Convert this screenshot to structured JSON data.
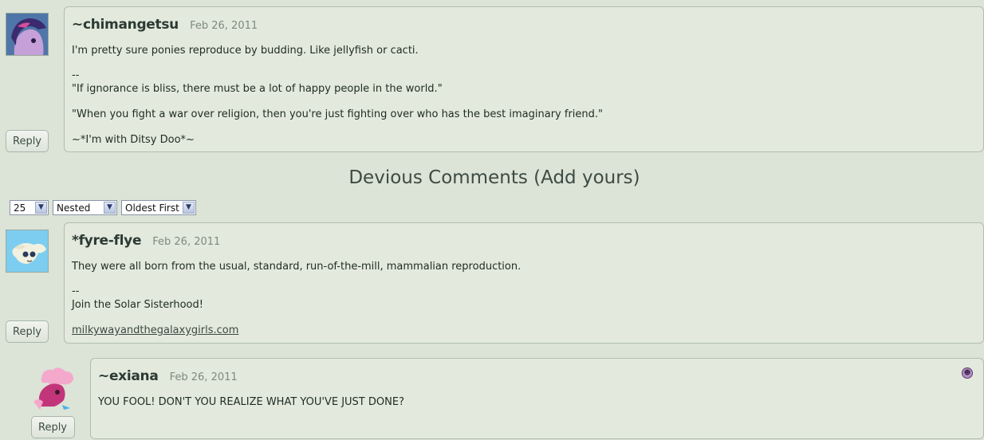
{
  "comments": [
    {
      "username": "~chimangetsu",
      "date": "Feb 26, 2011",
      "lines": [
        "I'm pretty sure ponies reproduce by budding. Like jellyfish or cacti.",
        "--",
        "\"If ignorance is bliss, there must be a lot of happy people in the world.\"",
        "\"When you fight a war over religion, then you're just fighting over who has the best imaginary friend.\"",
        "~*I'm with Ditsy Doo*~"
      ],
      "reply_label": "Reply"
    },
    {
      "username": "*fyre-flye",
      "date": "Feb 26, 2011",
      "lines": [
        "They were all born from the usual, standard, run-of-the-mill, mammalian reproduction.",
        "--",
        "Join the Solar Sisterhood!"
      ],
      "link": "milkywayandthegalaxygirls.com",
      "reply_label": "Reply"
    },
    {
      "username": "~exiana",
      "date": "Feb 26, 2011",
      "lines": [
        "YOU FOOL! DON'T YOU REALIZE WHAT YOU'VE JUST DONE?"
      ],
      "reply_label": "Reply"
    }
  ],
  "section": {
    "title": "Devious Comments",
    "add_label": "(Add yours)"
  },
  "controls": {
    "per_page": "25",
    "view_mode": "Nested",
    "sort_order": "Oldest First"
  },
  "icons": {
    "dropdown": "chevron-down-icon",
    "badge": "purple-skull-badge-icon"
  },
  "colors": {
    "background": "#dce3d7",
    "card": "#e3e9dd",
    "text": "#1e2b24"
  }
}
